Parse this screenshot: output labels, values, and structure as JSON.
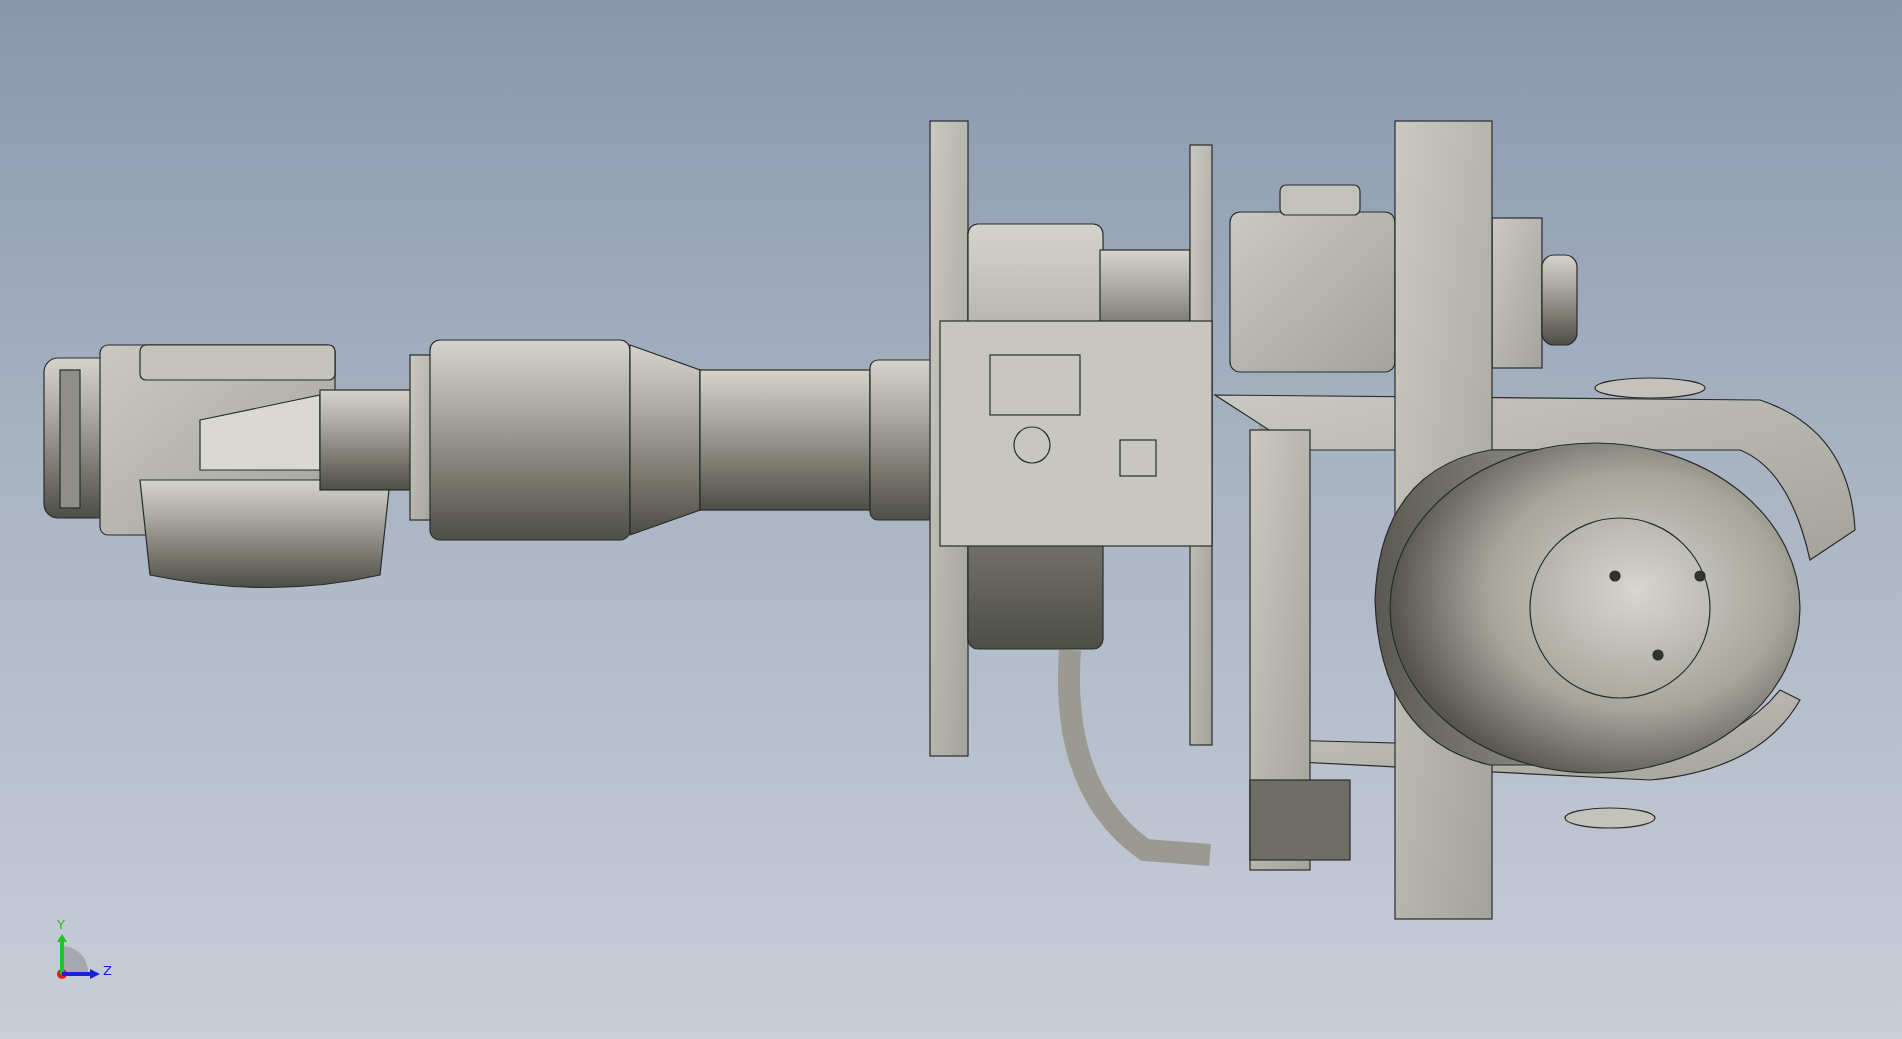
{
  "triad": {
    "axes": [
      {
        "label": "Y",
        "kind": "y"
      },
      {
        "label": "Z",
        "kind": "z"
      }
    ]
  }
}
